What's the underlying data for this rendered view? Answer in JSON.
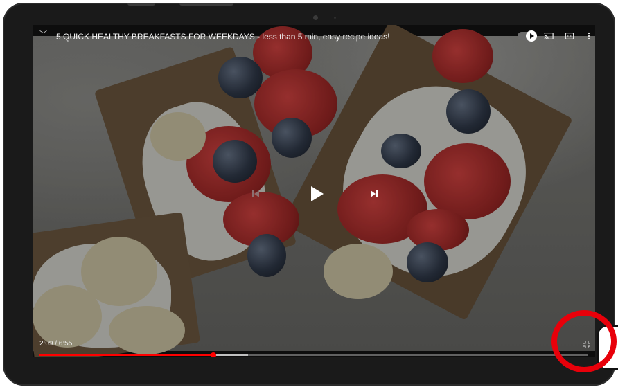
{
  "video": {
    "title": "5 QUICK HEALTHY BREAKFASTS FOR WEEKDAYS - less than 5 min, easy recipe ideas!",
    "time_display": "2:09 / 6:55",
    "progress_fraction": 0.317,
    "buffered_fraction": 0.38
  },
  "icons": {
    "collapse": "chevron-down-icon",
    "autoplay": "autoplay-toggle-icon",
    "cast": "cast-icon",
    "captions": "captions-icon",
    "more": "more-vert-icon",
    "previous": "previous-icon",
    "play": "play-icon",
    "next": "next-icon",
    "fullscreen": "exit-fullscreen-icon"
  },
  "colors": {
    "progress": "#ff0000",
    "highlight_circle": "#e8000a"
  }
}
